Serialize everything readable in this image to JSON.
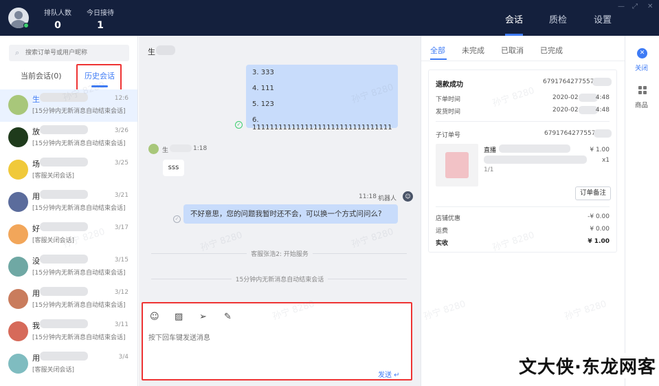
{
  "topbar": {
    "stats": [
      {
        "label": "排队人数",
        "value": "0"
      },
      {
        "label": "今日接待",
        "value": "1"
      }
    ],
    "nav": [
      "会话",
      "质检",
      "设置"
    ],
    "window_controls": [
      "—",
      "⤢",
      "✕"
    ]
  },
  "sidebar_left": {
    "search_placeholder": "搜索订单号或用户昵称",
    "tabs": [
      "当前会话(0)",
      "历史会话"
    ],
    "conversations": [
      {
        "name": "生",
        "date": "12:6",
        "msg": "[15分钟内无新消息自动结束会话]"
      },
      {
        "name": "放",
        "date": "3/26",
        "msg": "[15分钟内无新消息自动结束会话]"
      },
      {
        "name": "场",
        "date": "3/25",
        "msg": "[客服关闭会话]"
      },
      {
        "name": "用",
        "date": "3/21",
        "msg": "[15分钟内无新消息自动结束会话]"
      },
      {
        "name": "好",
        "date": "3/17",
        "msg": "[客服关闭会话]"
      },
      {
        "name": "没",
        "date": "3/15",
        "msg": "[15分钟内无新消息自动结束会话]"
      },
      {
        "name": "用",
        "date": "3/12",
        "msg": "[15分钟内无新消息自动结束会话]"
      },
      {
        "name": "我",
        "date": "3/11",
        "msg": "[15分钟内无新消息自动结束会话]"
      },
      {
        "name": "用",
        "date": "3/4",
        "msg": "[客服关闭会话]"
      }
    ]
  },
  "chat": {
    "title": "生",
    "list_lines": [
      "3. 333",
      "4. 111",
      "5. 123",
      "6. 11111111111111111111111111111111"
    ],
    "incoming_name": "生",
    "incoming_time": "1:18",
    "incoming_msg": "sss",
    "robot_time": "11:18",
    "robot_label": "机器人",
    "robot_msg": "不好意思，您的问题我暂时还不会，可以换一个方式问问么?",
    "system_1": "客服张浩2: 开始服务",
    "system_2": "15分钟内无新消息自动结束会话",
    "input_placeholder": "按下回车键发送消息",
    "send_label": "发送"
  },
  "order": {
    "tabs": [
      "全部",
      "未完成",
      "已取消",
      "已完成"
    ],
    "status": "退款成功",
    "order_no": "67917642775574",
    "order_time_label": "下单时间",
    "order_time": "2020-02",
    "order_time_tail": "4:48",
    "ship_time_label": "发货时间",
    "ship_time": "2020-02",
    "ship_time_tail": "4:48",
    "sub_order_label": "子订单号",
    "sub_order_no": "67917642775574",
    "product_name": "直播",
    "product_price": "¥ 1.00",
    "product_qty": "x1",
    "product_index": "1/1",
    "remark_button": "订单备注",
    "shop_discount_label": "店铺优惠",
    "shop_discount": "-¥ 0.00",
    "freight_label": "运费",
    "freight": "¥ 0.00",
    "paid_label": "实收",
    "paid": "¥ 1.00"
  },
  "side_actions": [
    {
      "label": "关闭",
      "icon": "close-icon"
    },
    {
      "label": "商品",
      "icon": "grid-icon"
    }
  ],
  "watermark": "孙宁 8280",
  "brand_watermark": "文大侠·东龙网客",
  "colors": {
    "accent": "#3e7bf5",
    "topbar": "#14203d",
    "highlight_box": "#e33333",
    "online": "#3ccf6e"
  }
}
